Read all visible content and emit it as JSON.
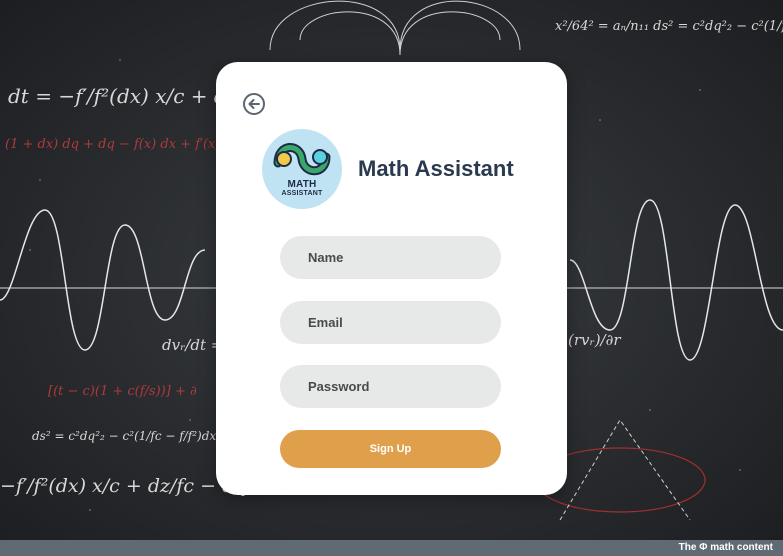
{
  "app": {
    "title": "Math Assistant"
  },
  "logo": {
    "line1": "MATH",
    "line2": "ASSISTANT"
  },
  "form": {
    "name_placeholder": "Name",
    "email_placeholder": "Email",
    "password_placeholder": "Password",
    "submit_label": "Sign Up"
  },
  "footer": {
    "text": "The Φ math content"
  },
  "colors": {
    "card": "#ffffff",
    "input_bg": "#e7e9e9",
    "button": "#e0a04b",
    "title": "#2a3a4e",
    "footer_bar": "#5f6a72"
  },
  "icons": {
    "back": "back-arrow-circle-icon"
  }
}
